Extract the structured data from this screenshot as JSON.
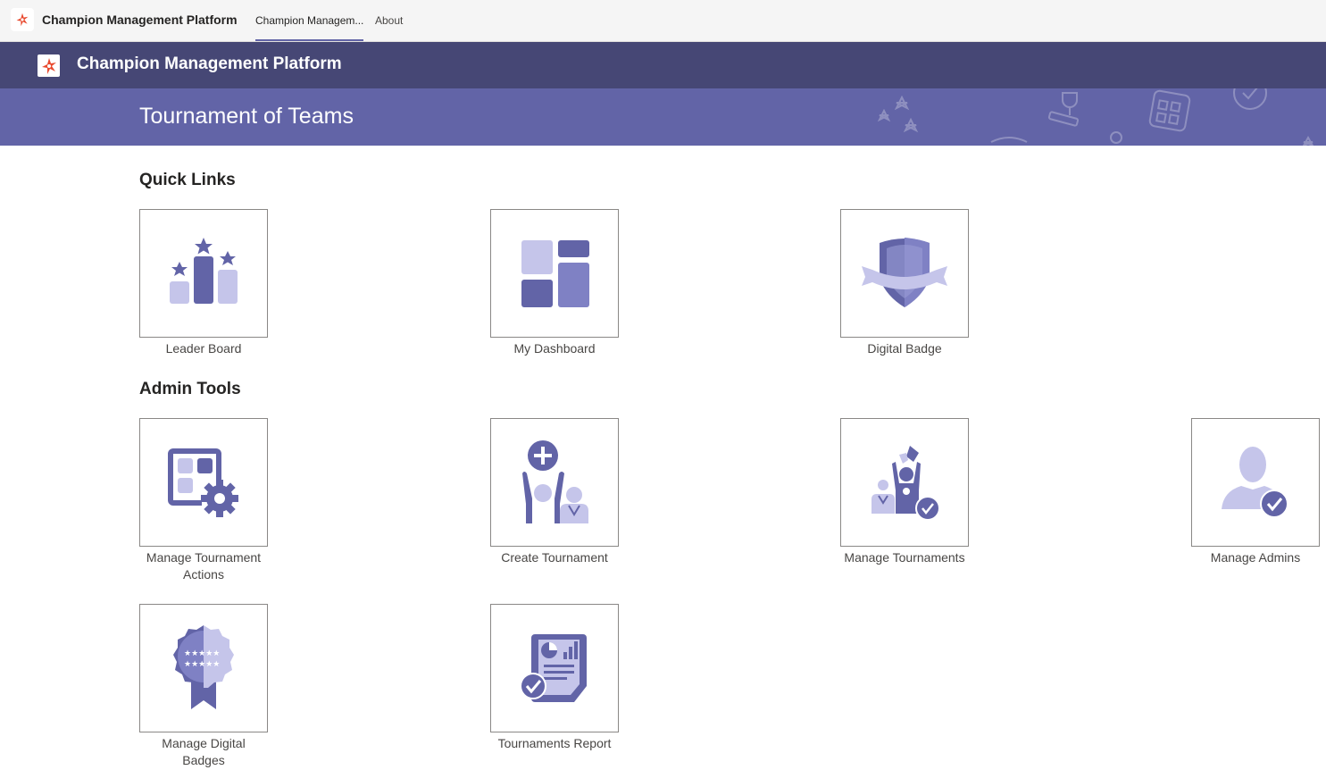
{
  "teams_bar": {
    "app_name": "Champion Management Platform",
    "tabs": [
      {
        "label": "Champion Managem..."
      },
      {
        "label": "About"
      }
    ]
  },
  "header": {
    "title": "Champion Management Platform"
  },
  "banner": {
    "title": "Tournament of Teams"
  },
  "quick_links": {
    "title": "Quick Links",
    "items": [
      {
        "label": "Leader Board",
        "icon": "leaderboard-icon"
      },
      {
        "label": "My Dashboard",
        "icon": "dashboard-icon"
      },
      {
        "label": "Digital Badge",
        "icon": "badge-icon"
      }
    ]
  },
  "admin_tools": {
    "title": "Admin Tools",
    "items": [
      {
        "label": "Manage Tournament Actions",
        "icon": "manage-actions-icon"
      },
      {
        "label": "Create Tournament",
        "icon": "create-tournament-icon"
      },
      {
        "label": "Manage Tournaments",
        "icon": "manage-tournaments-icon"
      },
      {
        "label": "Manage Admins",
        "icon": "manage-admins-icon"
      },
      {
        "label": "Manage Digital Badges",
        "icon": "manage-badges-icon"
      },
      {
        "label": "Tournaments Report",
        "icon": "report-icon"
      }
    ]
  },
  "colors": {
    "header": "#464775",
    "banner": "#6264a7",
    "icon_dark": "#6264a7",
    "icon_mid": "#7f81c4",
    "icon_light": "#c5c5ea",
    "logo_accent": "#e8492e"
  }
}
